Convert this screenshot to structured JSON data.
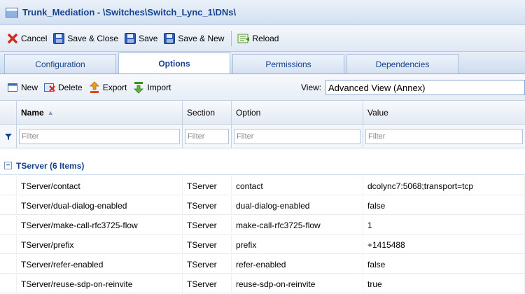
{
  "window": {
    "title": "Trunk_Mediation - \\Switches\\Switch_Lync_1\\DNs\\"
  },
  "toolbar": {
    "cancel": "Cancel",
    "save_close": "Save & Close",
    "save": "Save",
    "save_new": "Save & New",
    "reload": "Reload"
  },
  "tabs": [
    {
      "label": "Configuration"
    },
    {
      "label": "Options"
    },
    {
      "label": "Permissions"
    },
    {
      "label": "Dependencies"
    }
  ],
  "options_toolbar": {
    "new": "New",
    "delete": "Delete",
    "export": "Export",
    "import": "Import",
    "view_label": "View:",
    "view_value": "Advanced View (Annex)"
  },
  "grid": {
    "columns": [
      "Name",
      "Section",
      "Option",
      "Value"
    ],
    "filter_placeholder": "Filter",
    "group_label": "TServer (6 Items)",
    "rows": [
      [
        "TServer/contact",
        "TServer",
        "contact",
        "dcolync7:5068;transport=tcp"
      ],
      [
        "TServer/dual-dialog-enabled",
        "TServer",
        "dual-dialog-enabled",
        "false"
      ],
      [
        "TServer/make-call-rfc3725-flow",
        "TServer",
        "make-call-rfc3725-flow",
        "1"
      ],
      [
        "TServer/prefix",
        "TServer",
        "prefix",
        "+1415488"
      ],
      [
        "TServer/refer-enabled",
        "TServer",
        "refer-enabled",
        "false"
      ],
      [
        "TServer/reuse-sdp-on-reinvite",
        "TServer",
        "reuse-sdp-on-reinvite",
        "true"
      ]
    ]
  },
  "colors": {
    "accent": "#15428b",
    "border": "#b7c9e0"
  }
}
